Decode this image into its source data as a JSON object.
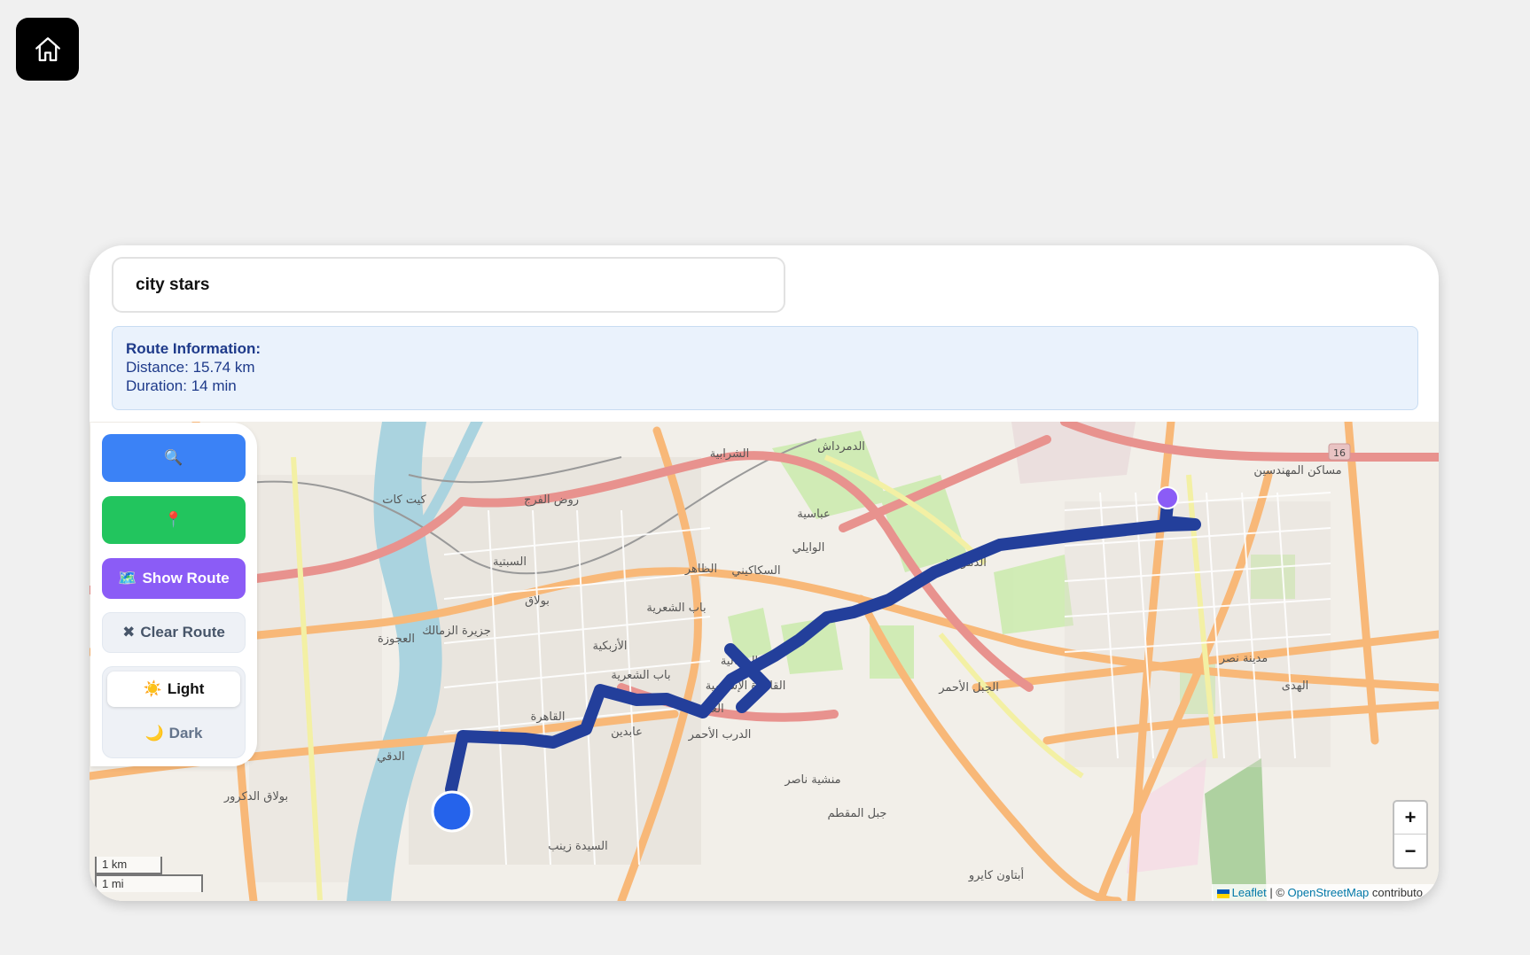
{
  "search": {
    "value": "city stars"
  },
  "route": {
    "heading": "Route Information:",
    "distance": "Distance: 15.74 km",
    "duration": "Duration: 14 min"
  },
  "controls": {
    "search_icon": "🔍",
    "locate_icon": "📍",
    "show_route_icon": "🗺️",
    "show_route_label": "Show Route",
    "clear_route_icon": "✖",
    "clear_route_label": "Clear Route",
    "light_icon": "☀️",
    "light_label": "Light",
    "dark_icon": "🌙",
    "dark_label": "Dark"
  },
  "map": {
    "zoom_in": "+",
    "zoom_out": "−",
    "scale_km": "1 km",
    "scale_mi": "1 mi",
    "attribution_leaflet": "Leaflet",
    "attribution_sep": " | © ",
    "attribution_osm": "OpenStreetMap",
    "attribution_suffix": " contributo",
    "labels": [
      "الشرابية",
      "الدمرداش",
      "روض الفرج",
      "كيت كات",
      "عباسية",
      "الوايلي",
      "الظاهر",
      "السكاكيني",
      "باب الشعرية",
      "السبتية",
      "بولاق",
      "جزيرة الزمالك",
      "العجوزة",
      "الأزبكية",
      "الجمالية",
      "القاهرة الإسلامية",
      "باب الشعرية",
      "القاهرة",
      "الغورية",
      "الدرب الأحمر",
      "عابدين",
      "الدقي",
      "بولاق الدكرور",
      "السيدة زينب",
      "منشية ناصر",
      "جبل المقطم",
      "الجبل الأحمر",
      "الدمرداش",
      "مدينة نصر",
      "الهدى",
      "أبتاون كايرو",
      "مساكن المهندسين",
      "16"
    ]
  },
  "colors": {
    "route": "#233f9b",
    "origin_marker": "#2563eb",
    "destination_marker": "#8b5cf6",
    "search_button": "#3b82f6",
    "locate_button": "#22c55e",
    "show_route_button": "#8b5cf6"
  }
}
